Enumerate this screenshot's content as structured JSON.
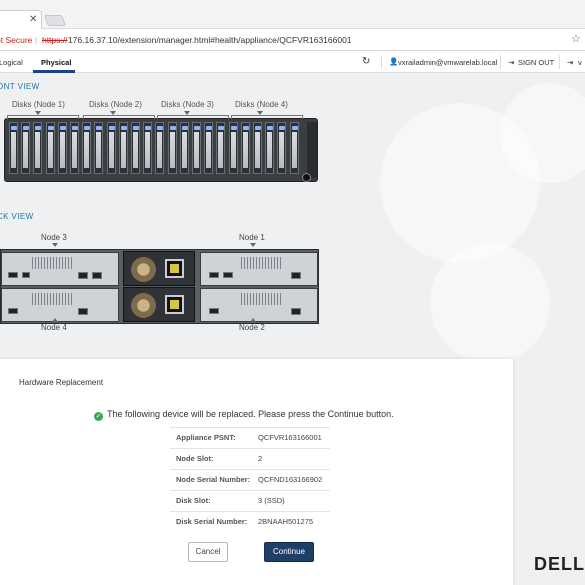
{
  "browser": {
    "security_warning": "ot Secure",
    "url_scheme": "https://",
    "url_rest": "176.16.37.10/extension/manager.html#health/appliance/QCFVR163166001"
  },
  "nav": {
    "tabs": [
      {
        "label": "Logical"
      },
      {
        "label": "Physical",
        "active": true
      }
    ],
    "user": "vxrailadmin@vmwarelab.local",
    "sign_out": "SIGN OUT",
    "extra": "v"
  },
  "front_view": {
    "title": "ONT VIEW",
    "disk_groups": [
      "Disks (Node 1)",
      "Disks (Node 2)",
      "Disks (Node 3)",
      "Disks (Node 4)"
    ]
  },
  "back_view": {
    "title": "CK VIEW",
    "nodes": {
      "top_left": "Node 3",
      "top_right": "Node 1",
      "bottom_left": "Node 4",
      "bottom_right": "Node 2"
    }
  },
  "dialog": {
    "title": "Hardware Replacement",
    "message": "The following device will be replaced. Please press the Continue button.",
    "fields": [
      {
        "label": "Appliance PSNT:",
        "value": "QCFVR163166001"
      },
      {
        "label": "Node Slot:",
        "value": "2"
      },
      {
        "label": "Node Serial Number:",
        "value": "QCFND163166902"
      },
      {
        "label": "Disk Slot:",
        "value": "3 (SSD)"
      },
      {
        "label": "Disk Serial Number:",
        "value": "2BNAAH501275"
      }
    ],
    "cancel_label": "Cancel",
    "continue_label": "Continue"
  },
  "brand": {
    "logo": "DELL"
  },
  "colors": {
    "accent": "#1e76a6",
    "primary_button": "#1e3f66",
    "success": "#3aa657",
    "warning": "#c5221f"
  }
}
